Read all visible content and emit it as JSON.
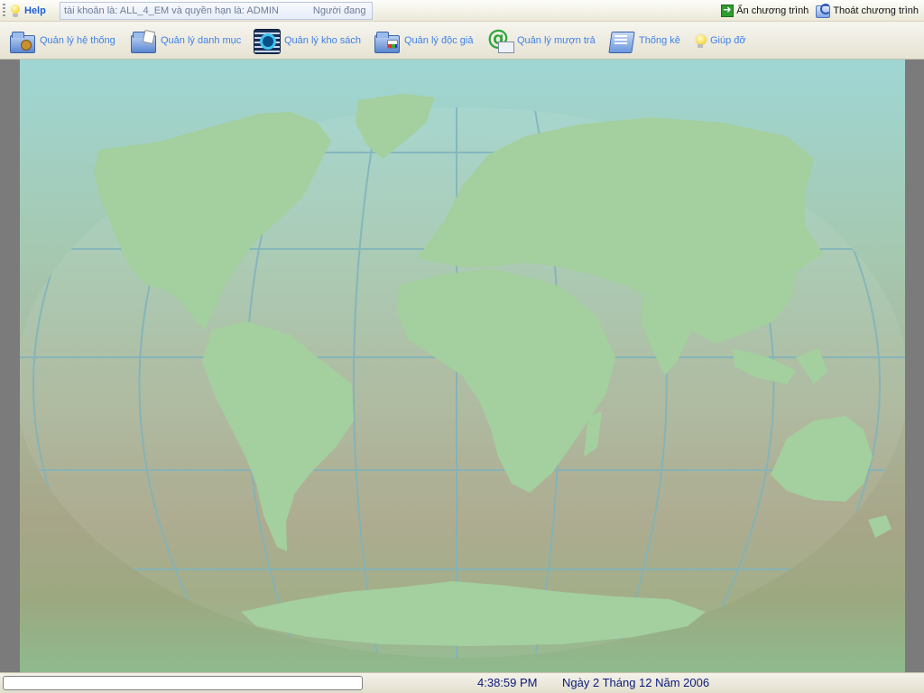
{
  "menu": {
    "help_label": "Help"
  },
  "marquee": {
    "account_text": "tài khoản là: ALL_4_EM và quyền hạn là: ADMIN",
    "trailing_text": "Người đang"
  },
  "window_actions": {
    "hide_label": "Ẩn chương trình",
    "exit_label": "Thoát chương trình"
  },
  "toolbar": {
    "items": [
      {
        "label": "Quản lý hệ thống",
        "icon": "system-folder-icon"
      },
      {
        "label": "Quản lý danh mục",
        "icon": "catalog-folder-icon"
      },
      {
        "label": "Quản lý kho sách",
        "icon": "book-stock-icon"
      },
      {
        "label": "Quản lý độc giả",
        "icon": "reader-folder-icon"
      },
      {
        "label": "Quản lý mượn trả",
        "icon": "email-at-icon"
      },
      {
        "label": "Thống kê",
        "icon": "statistics-folder-icon"
      },
      {
        "label": "Giúp đỡ",
        "icon": "lightbulb-icon"
      }
    ]
  },
  "status": {
    "progress_text": "",
    "time": "4:38:59 PM",
    "date": "Ngày 2 Tháng 12 Năm 2006"
  },
  "colors": {
    "toolbar_text": "#3f80e8",
    "help_text": "#1c5fd8",
    "status_text": "#0a1a7a",
    "side_bar": "#7b7b7b",
    "land": "#a4cf9e",
    "graticule": "#7fb3bb"
  }
}
